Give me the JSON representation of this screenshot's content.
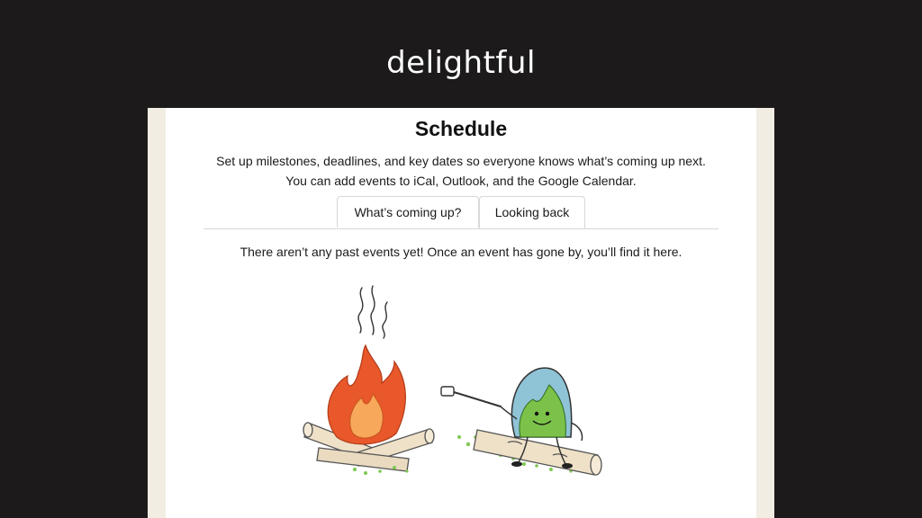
{
  "slide": {
    "title": "delightful"
  },
  "schedule": {
    "heading": "Schedule",
    "description": "Set up milestones, deadlines, and key dates so everyone knows what’s coming up next. You can add events to iCal, Outlook, and the Google Calendar.",
    "tabs": [
      {
        "label": "What’s coming up?"
      },
      {
        "label": "Looking back"
      }
    ],
    "active_tab": "Looking back",
    "empty_message": "There aren’t any past events yet! Once an event has gone by, you’ll find it here."
  },
  "illustration": {
    "icon": "campfire-marshmallow-illustration",
    "colors": {
      "flame": "#e8582a",
      "flame_inner": "#f7a85a",
      "character": "#7cc24a",
      "character_head": "#8fc3d6",
      "grass": "#7ec850",
      "log": "#efe1c8"
    }
  }
}
